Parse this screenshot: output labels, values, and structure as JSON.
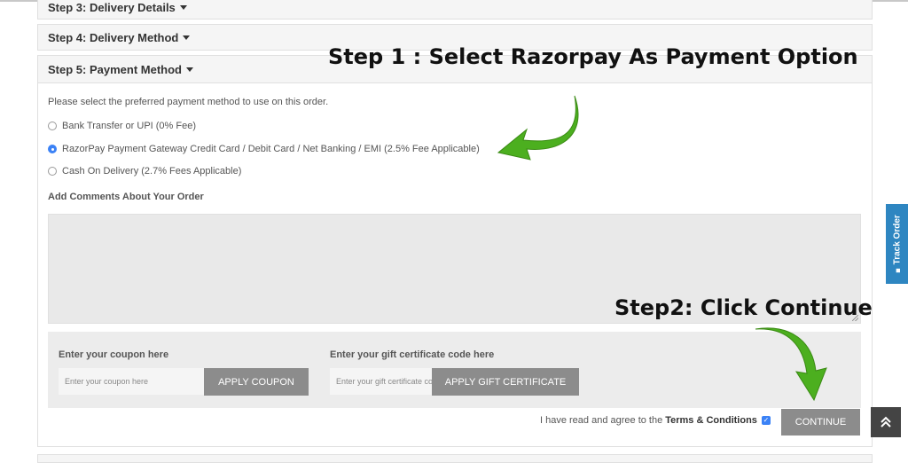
{
  "checkout": {
    "step3": "Step 3: Delivery Details",
    "step4": "Step 4: Delivery Method",
    "step5": "Step 5: Payment Method",
    "instruction": "Please select the preferred payment method to use on this order.",
    "payment_options": [
      {
        "label": "Bank Transfer or UPI (0% Fee)",
        "selected": false
      },
      {
        "label": "RazorPay Payment Gateway Credit Card / Debit Card / Net Banking / EMI (2.5% Fee Applicable)",
        "selected": true
      },
      {
        "label": "Cash On Delivery (2.7% Fees Applicable)",
        "selected": false
      }
    ],
    "comments_label": "Add Comments About Your Order",
    "coupon": {
      "label": "Enter your coupon here",
      "placeholder": "Enter your coupon here",
      "button": "APPLY COUPON"
    },
    "gift": {
      "label": "Enter your gift certificate code here",
      "placeholder": "Enter your gift certificate code here",
      "button": "APPLY GIFT CERTIFICATE"
    },
    "agree_text": "I have read and agree to the",
    "terms_link": "Terms & Conditions",
    "agree_checked": true,
    "continue_button": "CONTINUE"
  },
  "side": {
    "track_order": "Track Order",
    "track_icon": "truck-icon",
    "scroll_top_icon": "double-chevron-up-icon"
  },
  "annotations": {
    "step1": "Step 1 : Select Razorpay As Payment Option",
    "step2": "Step2: Click Continue",
    "arrow_color": "#4caf1f"
  },
  "colors": {
    "accent_blue": "#2e86c1",
    "button_gray": "#8c8c8c",
    "radio_blue": "#3b82f6"
  }
}
